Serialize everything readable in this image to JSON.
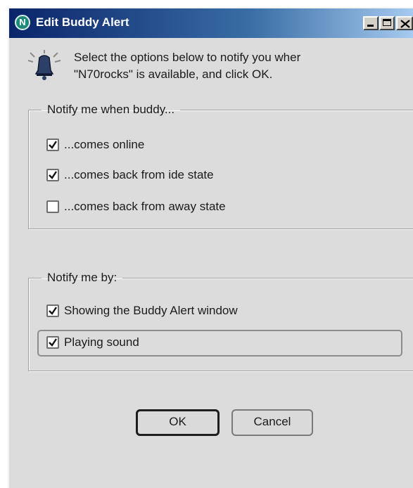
{
  "window": {
    "title": "Edit Buddy Alert",
    "app_icon_glyph": "N"
  },
  "intro": {
    "line1": "Select the options below to notify you wher",
    "line2": "\"N70rocks\"   is available, and click OK."
  },
  "buddy_group": {
    "legend": "Notify me when buddy...",
    "options": [
      {
        "label": "...comes online",
        "checked": true
      },
      {
        "label": "...comes back from ide state",
        "checked": true
      },
      {
        "label": "...comes back from away state",
        "checked": false
      }
    ]
  },
  "notify_group": {
    "legend": "Notify me by:",
    "options": [
      {
        "label": "Showing the Buddy Alert window",
        "checked": true
      },
      {
        "label": "Playing sound",
        "checked": true
      }
    ]
  },
  "buttons": {
    "ok": "OK",
    "cancel": "Cancel"
  },
  "icons": {
    "app": "app-logo-icon",
    "bell": "bell-alert-icon",
    "check": "checkmark-icon"
  }
}
